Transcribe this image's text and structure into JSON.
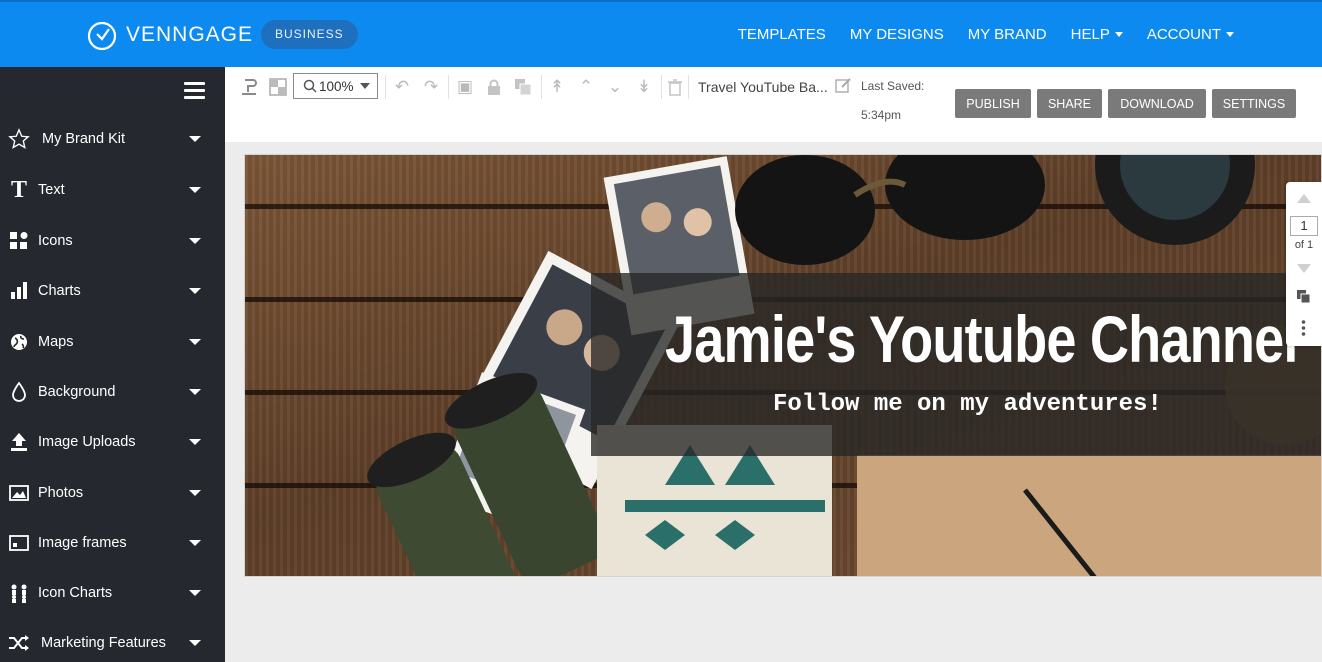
{
  "header": {
    "logo_text": "VENNGAGE",
    "plan_badge": "BUSINESS",
    "nav": [
      {
        "label": "TEMPLATES",
        "dropdown": false
      },
      {
        "label": "MY DESIGNS",
        "dropdown": false
      },
      {
        "label": "MY BRAND",
        "dropdown": false
      },
      {
        "label": "HELP",
        "dropdown": true
      },
      {
        "label": "ACCOUNT",
        "dropdown": true
      }
    ]
  },
  "sidebar": {
    "items": [
      {
        "label": "My Brand Kit",
        "icon": "star-icon"
      },
      {
        "label": "Text",
        "icon": "text-icon"
      },
      {
        "label": "Icons",
        "icon": "icons-grid-icon"
      },
      {
        "label": "Charts",
        "icon": "bar-chart-icon"
      },
      {
        "label": "Maps",
        "icon": "globe-icon"
      },
      {
        "label": "Background",
        "icon": "droplet-icon"
      },
      {
        "label": "Image Uploads",
        "icon": "upload-icon"
      },
      {
        "label": "Photos",
        "icon": "photo-icon"
      },
      {
        "label": "Image frames",
        "icon": "frame-icon"
      },
      {
        "label": "Icon Charts",
        "icon": "people-chart-icon"
      },
      {
        "label": "Marketing Features",
        "icon": "shuffle-icon"
      }
    ]
  },
  "toolbar": {
    "zoom": "100%",
    "document_title": "Travel YouTube Ba...",
    "last_saved_label": "Last Saved:",
    "last_saved_time": "5:34pm",
    "buttons": [
      "PUBLISH",
      "SHARE",
      "DOWNLOAD",
      "SETTINGS"
    ]
  },
  "canvas": {
    "headline": "Jamie's Youtube Channel",
    "subheadline": "Follow me on my adventures!"
  },
  "pager": {
    "current_page": "1",
    "total_label": "of 1"
  },
  "colors": {
    "header_bg": "#0d8af0",
    "sidebar_bg": "#25292f",
    "button_bg": "#7a7a7a"
  }
}
